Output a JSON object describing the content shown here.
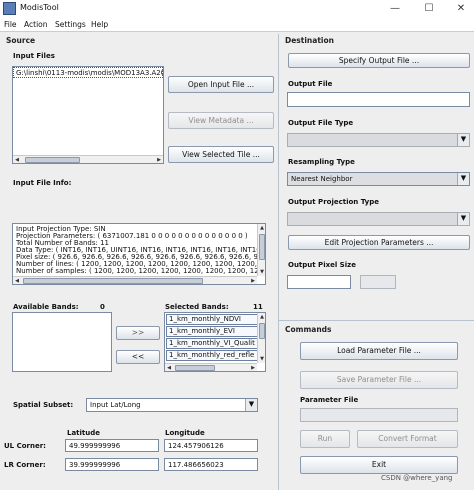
{
  "window": {
    "title": "ModisTool",
    "minimize": "—",
    "maximize": "☐",
    "close": "✕"
  },
  "menu": [
    "File",
    "Action",
    "Settings",
    "Help"
  ],
  "source": {
    "title": "Source",
    "input_files_label": "Input Files",
    "input_files": [
      "G:\\linshi\\0113-modis\\modis\\MOD13A3.A20"
    ],
    "open_input_file": "Open Input File ...",
    "view_metadata": "View Metadata ...",
    "view_selected_tile": "View Selected Tile ...",
    "input_file_info_label": "Input File Info:",
    "info_lines": [
      "Input Projection Type: SIN",
      "Projection Parameters: ( 6371007.181 0 0 0 0 0 0 0 0 0 0 0 0 0 0 )",
      "Total Number of Bands: 11",
      "Data Type: ( INT16, INT16, UINT16, INT16, INT16, INT16, INT16, INT16",
      "Pixel size: ( 926.6, 926.6, 926.6, 926.6, 926.6, 926.6, 926.6, 926.6, 9",
      "Number of lines: ( 1200, 1200, 1200, 1200, 1200, 1200, 1200, 1200, 12",
      "Number of samples: ( 1200, 1200, 1200, 1200, 1200, 1200, 1200, 1200,"
    ],
    "available_bands_label": "Available Bands:",
    "available_bands_count": "0",
    "selected_bands_label": "Selected Bands:",
    "selected_bands_count": "11",
    "selected_bands": [
      "1_km_monthly_NDVI",
      "1_km_monthly_EVI",
      "1_km_monthly_VI_Qualit",
      "1_km_monthly_red_refle"
    ],
    "add_button": ">>",
    "remove_button": "<<",
    "spatial_subset_label": "Spatial Subset:",
    "spatial_subset_value": "Input Lat/Long",
    "latitude_header": "Latitude",
    "longitude_header": "Longitude",
    "ul_corner_label": "UL Corner:",
    "ul_lat": "49.999999996",
    "ul_lon": "124.457906126",
    "lr_corner_label": "LR Corner:",
    "lr_lat": "39.999999996",
    "lr_lon": "117.486656023"
  },
  "destination": {
    "title": "Destination",
    "specify_output_file": "Specify Output File ...",
    "output_file_label": "Output File",
    "output_file_value": "",
    "output_file_type_label": "Output File Type",
    "output_file_type_value": "",
    "resampling_type_label": "Resampling Type",
    "resampling_type_value": "Nearest Neighbor",
    "output_projection_type_label": "Output Projection Type",
    "output_projection_type_value": "",
    "edit_projection_parameters": "Edit Projection Parameters ...",
    "output_pixel_size_label": "Output Pixel Size",
    "output_pixel_size_value": ""
  },
  "commands": {
    "title": "Commands",
    "load_parameter_file": "Load Parameter File ...",
    "save_parameter_file": "Save Parameter File ...",
    "parameter_file_label": "Parameter File",
    "parameter_file_value": "",
    "run": "Run",
    "convert_format": "Convert Format",
    "exit": "Exit"
  },
  "watermark": "CSDN @where_yang",
  "colors": {
    "accent": "#5a7fb6",
    "panel_bg": "#eeeeee",
    "button_border": "#8a99ad"
  }
}
